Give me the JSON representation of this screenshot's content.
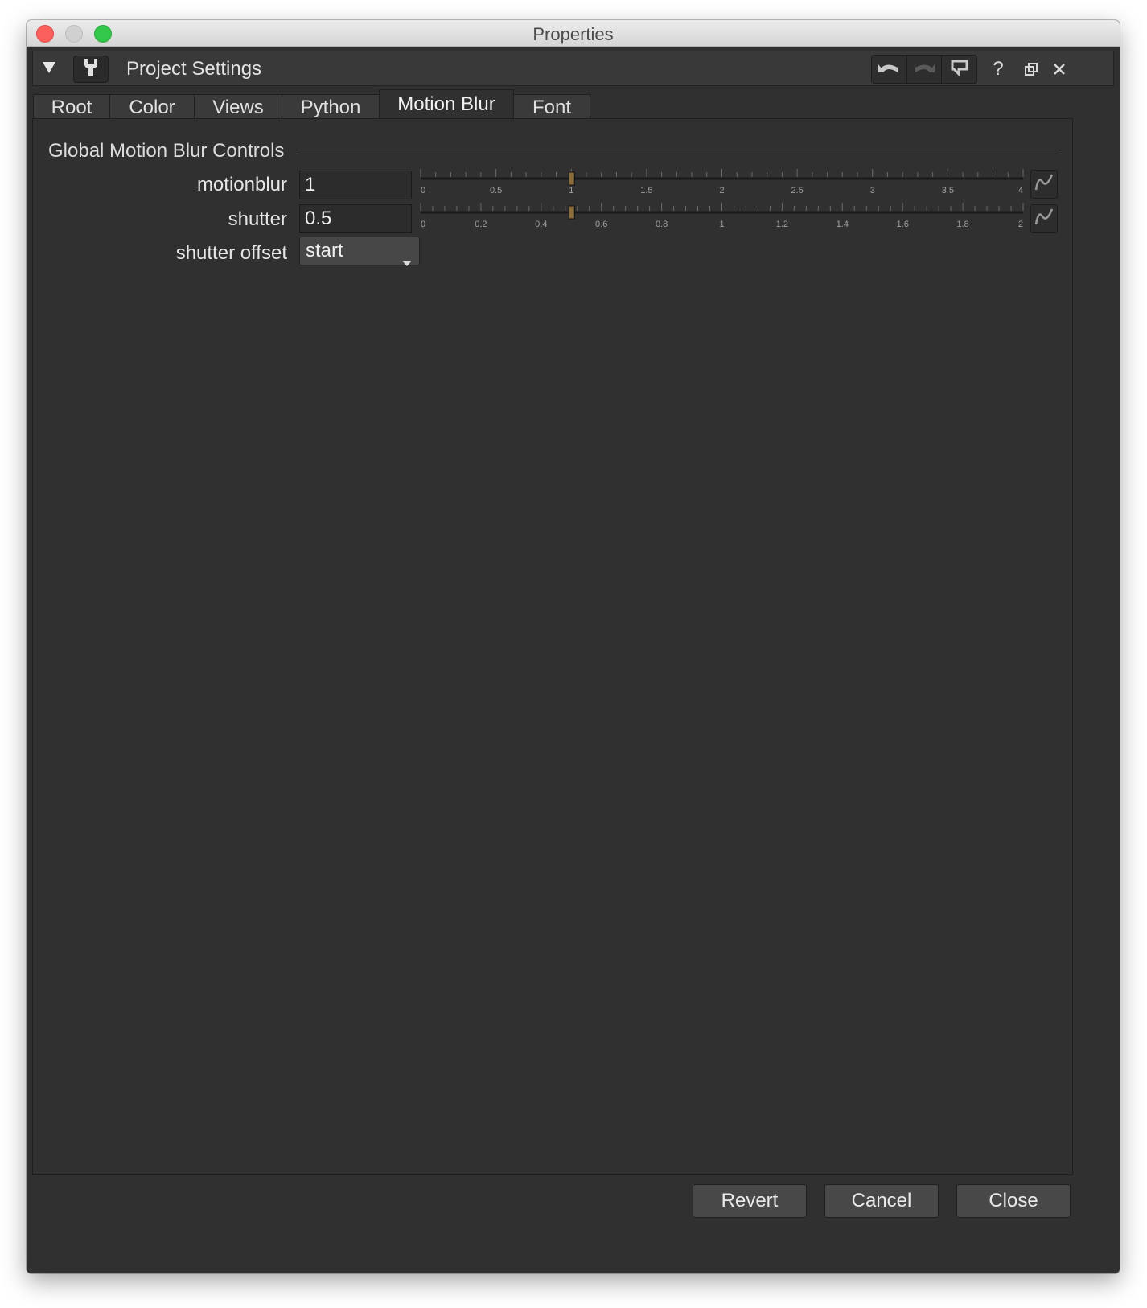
{
  "window": {
    "title": "Properties"
  },
  "panel": {
    "title": "Project Settings"
  },
  "tabs": [
    {
      "label": "Root",
      "active": false
    },
    {
      "label": "Color",
      "active": false
    },
    {
      "label": "Views",
      "active": false
    },
    {
      "label": "Python",
      "active": false
    },
    {
      "label": "Motion Blur",
      "active": true
    },
    {
      "label": "Font",
      "active": false
    }
  ],
  "group": {
    "title": "Global Motion Blur Controls"
  },
  "knobs": {
    "motionblur": {
      "label": "motionblur",
      "value": "1",
      "slider_min": 0,
      "slider_max": 4,
      "tick_labels": [
        "0",
        "0.5",
        "1",
        "1.5",
        "2",
        "2.5",
        "3",
        "3.5",
        "4"
      ]
    },
    "shutter": {
      "label": "shutter",
      "value": "0.5",
      "slider_min": 0,
      "slider_max": 2,
      "tick_labels": [
        "0",
        "0.2",
        "0.4",
        "0.6",
        "0.8",
        "1",
        "1.2",
        "1.4",
        "1.6",
        "1.8",
        "2"
      ]
    },
    "shutter_offset": {
      "label": "shutter offset",
      "value": "start"
    }
  },
  "footer": {
    "revert": "Revert",
    "cancel": "Cancel",
    "close": "Close"
  },
  "colors": {
    "background": "#303030",
    "slider_handle": "#8a6d3b"
  }
}
